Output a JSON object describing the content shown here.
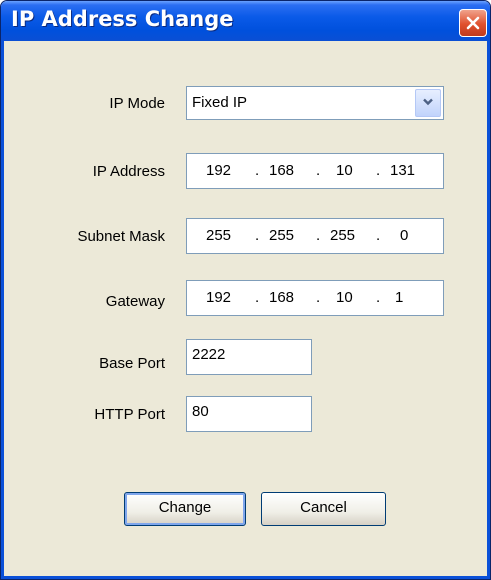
{
  "window": {
    "title": "IP Address Change"
  },
  "form": {
    "ip_mode": {
      "label": "IP Mode",
      "value": "Fixed IP"
    },
    "ip_address": {
      "label": "IP Address",
      "octets": [
        "192",
        "168",
        "10",
        "131"
      ]
    },
    "subnet_mask": {
      "label": "Subnet Mask",
      "octets": [
        "255",
        "255",
        "255",
        "0"
      ]
    },
    "gateway": {
      "label": "Gateway",
      "octets": [
        "192",
        "168",
        "10",
        "1"
      ]
    },
    "base_port": {
      "label": "Base Port",
      "value": "2222"
    },
    "http_port": {
      "label": "HTTP Port",
      "value": "80"
    },
    "separator": "."
  },
  "buttons": {
    "change": "Change",
    "cancel": "Cancel"
  },
  "colors": {
    "titlebar": "#0a5ae8",
    "dialog_background": "#ece9d8",
    "close_button": "#e0502d"
  },
  "icons": {
    "close": "close-icon",
    "dropdown": "chevron-down-icon"
  }
}
